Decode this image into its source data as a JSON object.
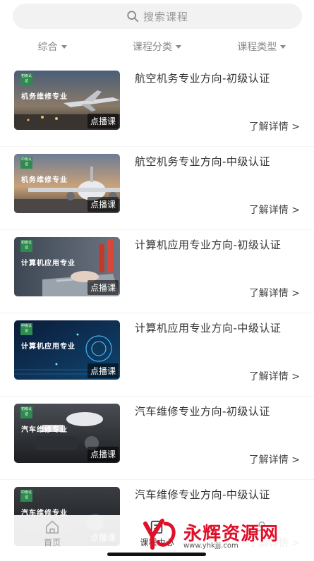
{
  "search": {
    "placeholder": "搜索课程"
  },
  "filters": [
    {
      "label": "综合"
    },
    {
      "label": "课程分类"
    },
    {
      "label": "课程类型"
    }
  ],
  "courses": [
    {
      "badge": "初级认证",
      "thumb_title": "机务维修专业",
      "tag": "点播课",
      "title": "航空机务专业方向-初级认证",
      "detail": "了解详情 >",
      "theme": "plane-sunset"
    },
    {
      "badge": "中级认证",
      "thumb_title": "机务维修专业",
      "tag": "点播课",
      "title": "航空机务专业方向-中级认证",
      "detail": "了解详情 >",
      "theme": "plane-front"
    },
    {
      "badge": "初级认证",
      "thumb_title": "计算机应用专业",
      "tag": "点播课",
      "title": "计算机应用专业方向-初级认证",
      "detail": "了解详情 >",
      "theme": "laptop"
    },
    {
      "badge": "中级认证",
      "thumb_title": "计算机应用专业",
      "tag": "点播课",
      "title": "计算机应用专业方向-中级认证",
      "detail": "了解详情 >",
      "theme": "tech-blue"
    },
    {
      "badge": "初级认证",
      "thumb_title": "汽车维修专业",
      "tag": "点播课",
      "title": "汽车维修专业方向-初级认证",
      "detail": "了解详情 >",
      "theme": "engine"
    },
    {
      "badge": "中级认证",
      "thumb_title": "汽车维修专业",
      "tag": "点播课",
      "title": "汽车维修专业方向-中级认证",
      "detail": "了解详情 >",
      "theme": "engine-dark"
    }
  ],
  "tabbar": [
    {
      "label": "首页",
      "icon": "home-icon"
    },
    {
      "label": "课程中心",
      "icon": "course-icon"
    },
    {
      "label": "",
      "icon": "profile-icon"
    }
  ],
  "watermark": {
    "text": "永辉资源网",
    "url": "www.yhkjjj.com"
  }
}
